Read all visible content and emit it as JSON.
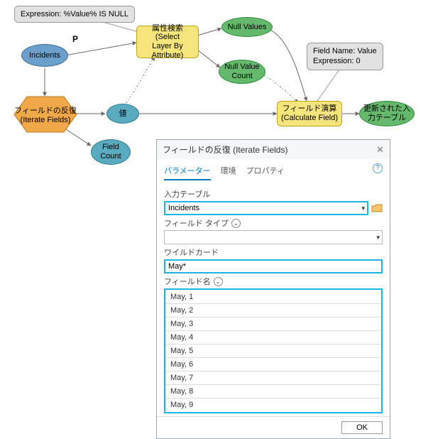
{
  "diagram": {
    "callout_slba": {
      "line1": "Expression: %Value% IS NULL"
    },
    "callout_calc": {
      "line1": "Field Name: Value",
      "line2": "Expression: 0"
    },
    "p_marker": "P",
    "incidents": "Incidents",
    "iterate": {
      "line1": "フィールドの反復",
      "line2": "(Iterate Fields)"
    },
    "value_node": "値",
    "field_count": {
      "line1": "Field",
      "line2": "Count"
    },
    "slba": {
      "line1": "属性検索 (Select",
      "line2": "Layer By",
      "line3": "Attribute)"
    },
    "null_values": "Null Values",
    "null_value_count": {
      "line1": "Null Value",
      "line2": "Count"
    },
    "calc_field": {
      "line1": "フィールド演算",
      "line2": "(Calculate Field)"
    },
    "updated": {
      "line1": "更新された入",
      "line2": "力テーブル"
    }
  },
  "dialog": {
    "title": "フィールドの反復 (Iterate Fields)",
    "tabs": {
      "parameter": "パラメーター",
      "environment": "環境",
      "properties": "プロパティ"
    },
    "labels": {
      "input_table": "入力テーブル",
      "field_type": "フィールド タイプ",
      "wildcard": "ワイルドカード",
      "field_name": "フィールド名"
    },
    "input_table_value": "Incidents",
    "field_type_value": "",
    "wildcard_value": "May*",
    "fields": [
      "May, 1",
      "May, 2",
      "May, 3",
      "May, 4",
      "May, 5",
      "May, 6",
      "May, 7",
      "May, 8",
      "May, 9"
    ],
    "ok": "OK"
  }
}
